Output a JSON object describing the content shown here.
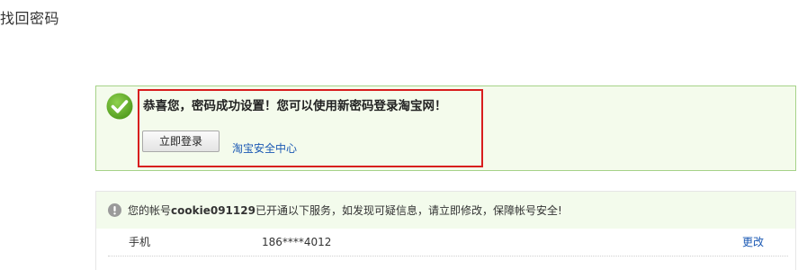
{
  "page": {
    "title": "找回密码"
  },
  "success": {
    "message": "恭喜您，密码成功设置！您可以使用新密码登录淘宝网！",
    "login_button": "立即登录",
    "security_center_link": "淘宝安全中心",
    "icon": "check-circle-icon",
    "accent_color": "#6ab42b",
    "highlight_color": "#d81e1e"
  },
  "account_notice": {
    "prefix": "您的帐号",
    "account": "cookie091129",
    "suffix": "已开通以下服务，如发现可疑信息，请立即修改，保障帐号安全!",
    "icon": "alert-circle-icon"
  },
  "services": [
    {
      "name": "手机",
      "value": "186****4012",
      "action": "更改"
    }
  ]
}
